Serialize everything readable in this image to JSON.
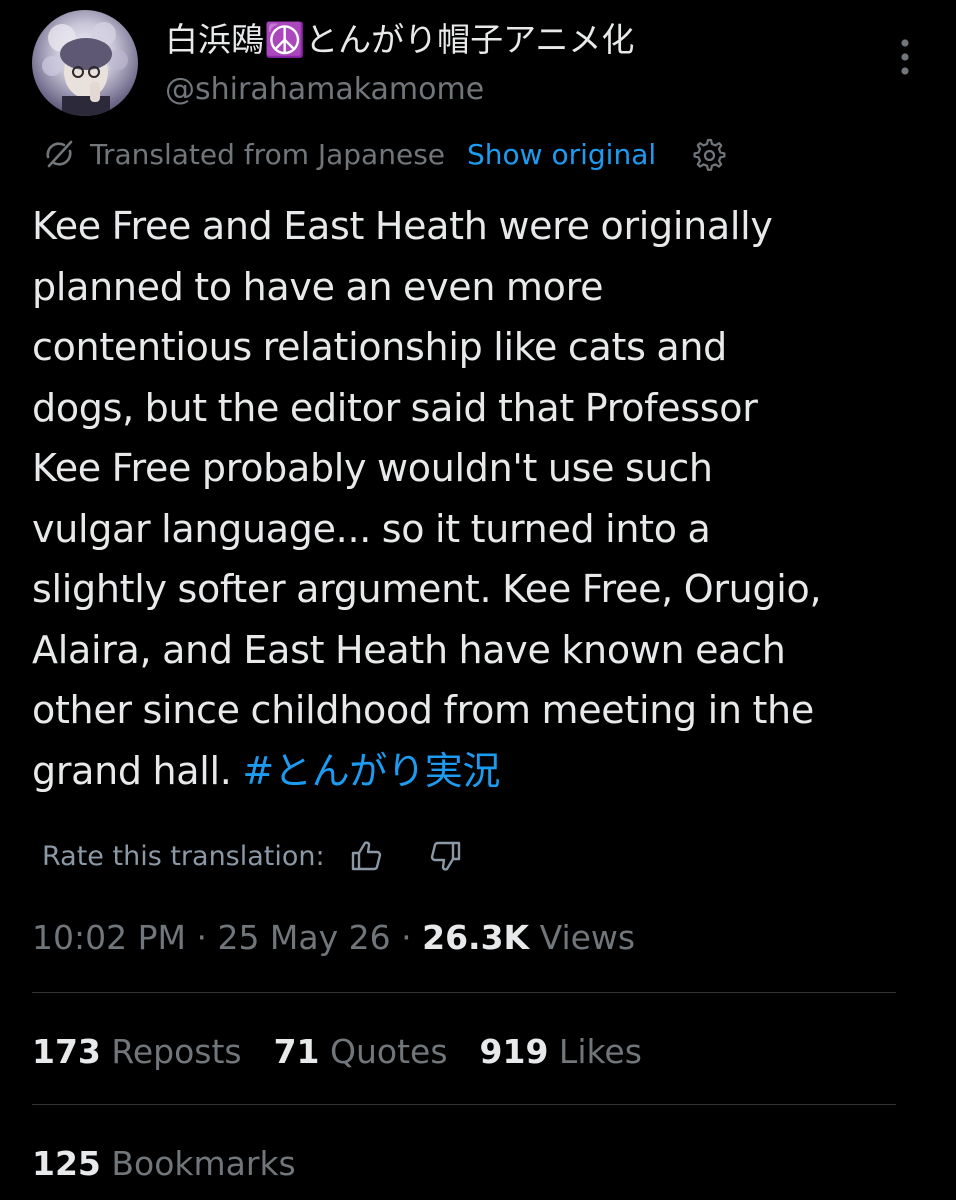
{
  "author": {
    "display_name": "白浜鴎☮️とんがり帽子アニメ化",
    "handle": "@shirahamakamome",
    "avatar_icon": "profile-avatar-illustration"
  },
  "translation": {
    "label": "Translated from Japanese",
    "show_original": "Show original",
    "rate_label": "Rate this translation:"
  },
  "tweet": {
    "lines": [
      "Kee Free and East Heath were originally",
      "planned to have an even more",
      "contentious relationship like cats and",
      "dogs, but the editor said that Professor",
      "Kee Free probably wouldn't use such",
      "vulgar language... so it turned into a",
      "slightly softer argument. Kee Free, Orugio,",
      "Alaira, and East Heath have known each",
      "other since childhood from meeting in the"
    ],
    "last_line_text": "grand hall. ",
    "hashtag": "#とんがり実況"
  },
  "meta": {
    "time": "10:02 PM",
    "sep1": " · ",
    "date": "25 May 26",
    "sep2": " · ",
    "views_count": "26.3K",
    "views_label": " Views"
  },
  "stats": {
    "reposts_count": "173",
    "reposts_label": " Reposts",
    "quotes_count": "71",
    "quotes_label": " Quotes",
    "likes_count": "919",
    "likes_label": " Likes",
    "bookmarks_count": "125",
    "bookmarks_label": " Bookmarks"
  },
  "colors": {
    "background": "#000000",
    "text": "#e7e9ea",
    "secondary": "#71767b",
    "accent": "#1d9bf0",
    "divider": "#2f3336"
  }
}
